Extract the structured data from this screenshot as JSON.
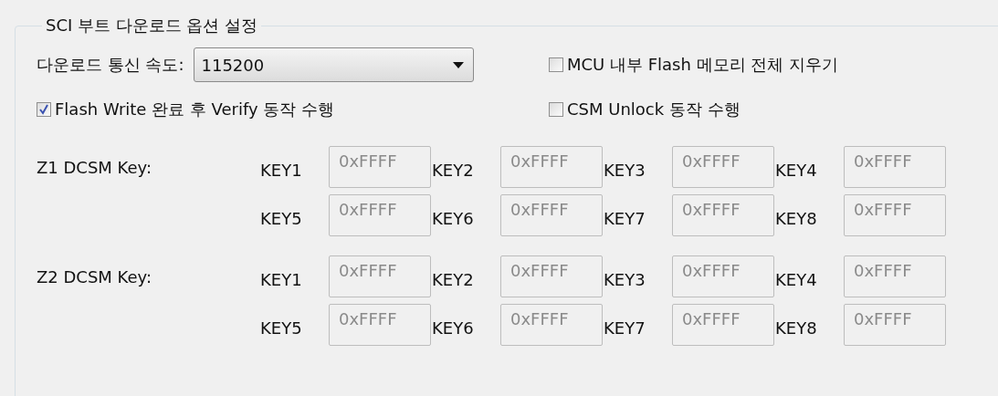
{
  "group": {
    "title": "SCI 부트 다운로드 옵션 설정"
  },
  "baud": {
    "label": "다운로드 통신 속도:",
    "value": "115200"
  },
  "options": [
    {
      "label": "MCU 내부 Flash 메모리 전체 지우기",
      "checked": false
    },
    {
      "label": "Flash Write 완료 후 Verify 동작 수행",
      "checked": true
    },
    {
      "label": "CSM Unlock 동작 수행",
      "checked": false
    }
  ],
  "key_groups": [
    {
      "label": "Z1 DCSM Key:",
      "keys": [
        {
          "label": "KEY1",
          "value": "0xFFFF",
          "disabled": true
        },
        {
          "label": "KEY2",
          "value": "0xFFFF",
          "disabled": true
        },
        {
          "label": "KEY3",
          "value": "0xFFFF",
          "disabled": true
        },
        {
          "label": "KEY4",
          "value": "0xFFFF",
          "disabled": true
        },
        {
          "label": "KEY5",
          "value": "0xFFFF",
          "disabled": true
        },
        {
          "label": "KEY6",
          "value": "0xFFFF",
          "disabled": true
        },
        {
          "label": "KEY7",
          "value": "0xFFFF",
          "disabled": true
        },
        {
          "label": "KEY8",
          "value": "0xFFFF",
          "disabled": true
        }
      ]
    },
    {
      "label": "Z2 DCSM Key:",
      "keys": [
        {
          "label": "KEY1",
          "value": "0xFFFF",
          "disabled": true
        },
        {
          "label": "KEY2",
          "value": "0xFFFF",
          "disabled": true
        },
        {
          "label": "KEY3",
          "value": "0xFFFF",
          "disabled": true
        },
        {
          "label": "KEY4",
          "value": "0xFFFF",
          "disabled": true
        },
        {
          "label": "KEY5",
          "value": "0xFFFF",
          "disabled": true
        },
        {
          "label": "KEY6",
          "value": "0xFFFF",
          "disabled": true
        },
        {
          "label": "KEY7",
          "value": "0xFFFF",
          "disabled": true
        },
        {
          "label": "KEY8",
          "value": "0xFFFF",
          "disabled": true
        }
      ]
    }
  ]
}
